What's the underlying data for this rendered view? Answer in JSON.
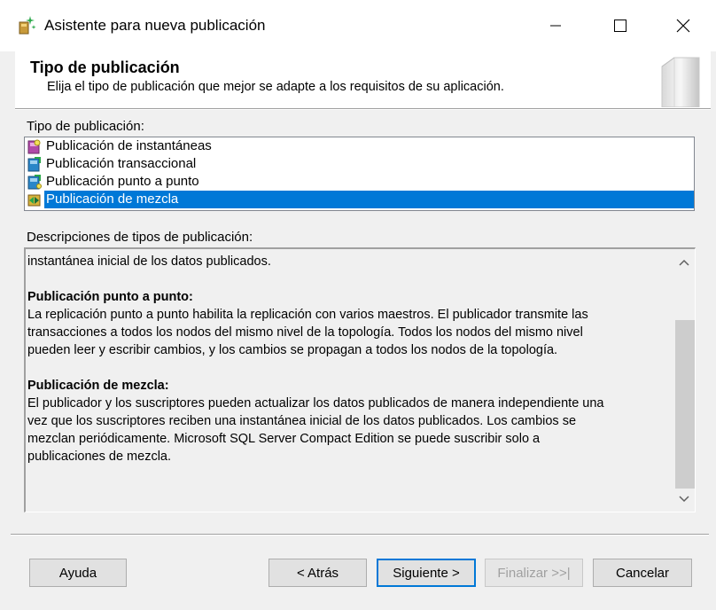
{
  "window": {
    "title": "Asistente para nueva publicación",
    "icon": "wizard-icon"
  },
  "header": {
    "title": "Tipo de publicación",
    "subtitle": "Elija el tipo de publicación que mejor se adapte a los requisitos de su aplicación."
  },
  "publication_types": {
    "label": "Tipo de publicación:",
    "items": [
      {
        "label": "Publicación de instantáneas",
        "icon": "snapshot-publication-icon",
        "selected": false
      },
      {
        "label": "Publicación transaccional",
        "icon": "transactional-publication-icon",
        "selected": false
      },
      {
        "label": "Publicación punto a punto",
        "icon": "peer-to-peer-publication-icon",
        "selected": false
      },
      {
        "label": "Publicación de mezcla",
        "icon": "merge-publication-icon",
        "selected": true
      }
    ]
  },
  "descriptions": {
    "label": "Descripciones de tipos de publicación:",
    "top_line": "instantánea inicial de los datos publicados.",
    "p2p_heading": "Publicación punto a punto:",
    "p2p_lines": [
      "La replicación punto a punto habilita la replicación con varios maestros. El publicador transmite las",
      "transacciones a todos los nodos del mismo nivel de la topología. Todos los nodos del mismo nivel",
      "pueden leer y escribir cambios, y los cambios se propagan a todos los nodos de la topología."
    ],
    "merge_heading": "Publicación de mezcla:",
    "merge_lines": [
      "El publicador y los suscriptores pueden actualizar los datos publicados de manera independiente una",
      "vez que los suscriptores reciben una instantánea inicial de los datos publicados. Los cambios se",
      "mezclan periódicamente. Microsoft SQL Server Compact Edition se puede suscribir solo a",
      "publicaciones de mezcla."
    ]
  },
  "buttons": {
    "help": "Ayuda",
    "back": "< Atrás",
    "next": "Siguiente >",
    "finish": "Finalizar >>|",
    "cancel": "Cancelar"
  },
  "colors": {
    "selection": "#0078d7",
    "default_button_border": "#0078d7"
  }
}
